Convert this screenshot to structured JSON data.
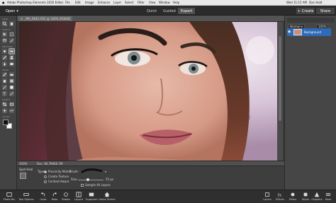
{
  "menubar": {
    "app_title": "Adobe Photoshop Elements 2020 Editor",
    "items": [
      "File",
      "Edit",
      "Image",
      "Enhance",
      "Layer",
      "Select",
      "Filter",
      "View",
      "Window",
      "Help"
    ],
    "clock": "Wed 11:15 AM",
    "user": "Dan Hold"
  },
  "appbar": {
    "open_label": "Open",
    "modes": [
      "Quick",
      "Guided",
      "Expert"
    ],
    "active_mode": "Expert",
    "create_label": "Create",
    "share_label": "Share"
  },
  "tools": {
    "sections": [
      "VIEW",
      "SELECT",
      "ENHANCE",
      "DRAW",
      "MODIFY",
      "COLOR"
    ],
    "foreground_color": "#111111",
    "background_color": "#ffffff"
  },
  "document": {
    "tab_title": "_MG_0642.CR2 @ 100% (RGB/8)",
    "zoom": "100%",
    "doc_size": "Doc: 66.7M/66.7M"
  },
  "layers": {
    "blend_mode": "Normal",
    "opacity": "100%",
    "layer_name": "Background"
  },
  "options": {
    "tool_name": "Spot Heal",
    "type_label": "Type:",
    "type_options": [
      "Proximity Match",
      "Create Texture",
      "Content-Aware"
    ],
    "selected_type": "Proximity Match",
    "brush_label": "Brush:",
    "size_label": "Size:",
    "size_value": "55 px",
    "sample_all_layers": "Sample All Layers"
  },
  "taskbar": {
    "left": [
      "Photo Bin",
      "Tool Options",
      "Undo",
      "Redo",
      "Rotate",
      "Layout",
      "Organizer",
      "Home Screen"
    ],
    "right": [
      "Layers",
      "Effects",
      "Filters",
      "Styles",
      "Graphics",
      "More"
    ]
  }
}
